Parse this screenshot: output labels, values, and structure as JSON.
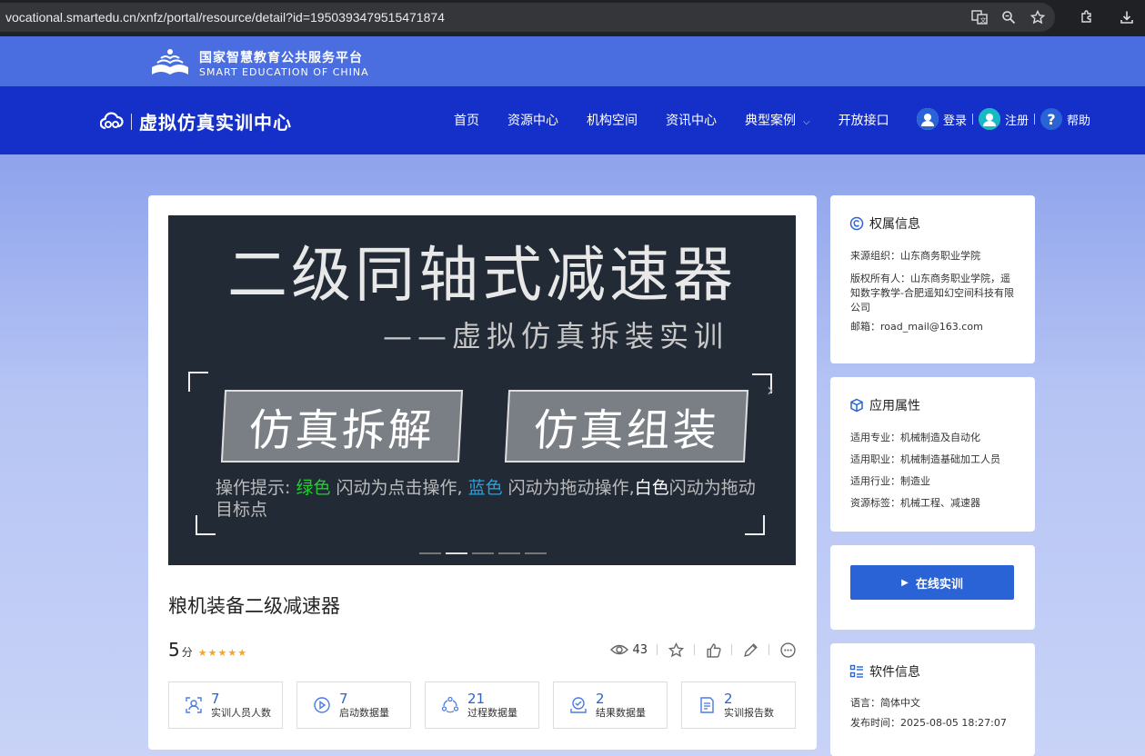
{
  "browser": {
    "url": "vocational.smartedu.cn/xnfz/portal/resource/detail?id=1950393479515471874",
    "icons": [
      "translate-icon",
      "zoom-icon",
      "star-icon",
      "extensions-icon",
      "download-icon"
    ]
  },
  "platform": {
    "title_cn": "国家智慧教育公共服务平台",
    "title_en": "SMART EDUCATION OF CHINA"
  },
  "nav": {
    "brand": "虚拟仿真实训中心",
    "menu": [
      {
        "label": "首页"
      },
      {
        "label": "资源中心"
      },
      {
        "label": "机构空间"
      },
      {
        "label": "资讯中心"
      },
      {
        "label": "典型案例"
      },
      {
        "label": "开放接口"
      }
    ],
    "dropdown_icon": "chevron-down-icon",
    "login": "登录",
    "register": "注册",
    "help": "帮助"
  },
  "banner": {
    "headline": "二级同轴式减速器",
    "subline": "——虚拟仿真拆装实训",
    "btn_disassemble": "仿真拆解",
    "btn_assemble": "仿真组装",
    "tip_prefix": "操作提示: ",
    "tip_green": "绿色",
    "tip_mid1": " 闪动为点击操作, ",
    "tip_blue": "蓝色",
    "tip_mid2": " 闪动为拖动操作,",
    "tip_white": "白色",
    "tip_end": "闪动为拖动目标点",
    "slide_count": 5,
    "active_slide": 2,
    "colors": {
      "green": "#22cc33",
      "blue": "#1aa3e8",
      "white": "#ffffff"
    }
  },
  "resource": {
    "title": "粮机装备二级减速器",
    "score": "5",
    "score_unit": "分",
    "stars": 5,
    "views": "43",
    "stats": [
      {
        "value": "7",
        "label": "实训人员人数",
        "icon": "person-frame-icon"
      },
      {
        "value": "7",
        "label": "启动数据量",
        "icon": "play-circle-icon"
      },
      {
        "value": "21",
        "label": "过程数据量",
        "icon": "cycle-icon"
      },
      {
        "value": "2",
        "label": "结果数据量",
        "icon": "check-tray-icon"
      },
      {
        "value": "2",
        "label": "实训报告数",
        "icon": "report-icon"
      }
    ]
  },
  "ownership": {
    "heading": "权属信息",
    "source": "来源组织：山东商务职业学院",
    "owner": "版权所有人：山东商务职业学院，遥知数字教学-合肥遥知幻空间科技有限公司",
    "email": "邮箱：road_mail@163.com"
  },
  "application": {
    "heading": "应用属性",
    "major": "适用专业：机械制造及自动化",
    "job": "适用职业：机械制造基础加工人员",
    "industry": "适用行业：制造业",
    "tags": "资源标签：机械工程、减速器"
  },
  "online": {
    "button": "在线实训"
  },
  "software": {
    "heading": "软件信息",
    "language": "语言：简体中文",
    "published": "发布时间：2025-08-05 18:27:07"
  }
}
